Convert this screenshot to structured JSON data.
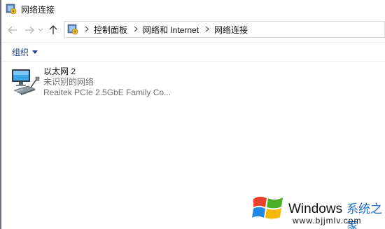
{
  "window": {
    "title": "网络连接"
  },
  "navigation": {
    "breadcrumbs": [
      "控制面板",
      "网络和 Internet",
      "网络连接"
    ]
  },
  "toolbar": {
    "organize_label": "组织"
  },
  "connections": [
    {
      "name": "以太网 2",
      "status": "未识别的网络",
      "device": "Realtek PCIe 2.5GbE Family Co..."
    }
  ],
  "watermark": {
    "brand": "Windows",
    "tagline": "系统之家",
    "url": "www.bjjmlv.com",
    "colors": {
      "red": "#e8412c",
      "green": "#4caf2a",
      "blue": "#1e88e5",
      "yellow": "#f5b800"
    }
  },
  "icons": [
    "control-panel-icon",
    "back-arrow-icon",
    "forward-arrow-icon",
    "recent-dropdown-icon",
    "up-arrow-icon",
    "chevron-right-icon",
    "caret-down-icon",
    "ethernet-adapter-icon",
    "windows-logo-icon"
  ]
}
